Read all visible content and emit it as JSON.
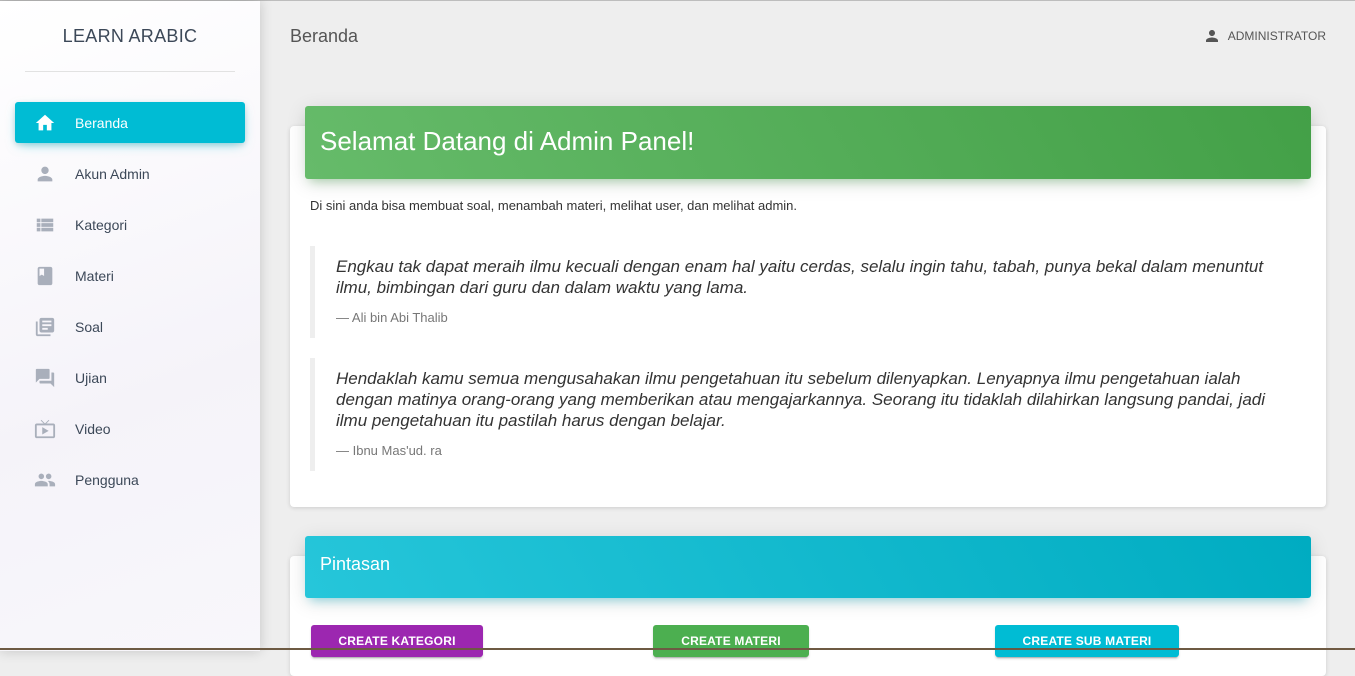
{
  "sidebar": {
    "brand": "LEARN ARABIC",
    "items": [
      {
        "label": "Beranda",
        "icon": "home-icon",
        "active": true
      },
      {
        "label": "Akun Admin",
        "icon": "person-icon"
      },
      {
        "label": "Kategori",
        "icon": "list-icon"
      },
      {
        "label": "Materi",
        "icon": "book-icon"
      },
      {
        "label": "Soal",
        "icon": "library-books-icon"
      },
      {
        "label": "Ujian",
        "icon": "forum-icon"
      },
      {
        "label": "Video",
        "icon": "live-tv-icon"
      },
      {
        "label": "Pengguna",
        "icon": "people-icon"
      }
    ]
  },
  "topbar": {
    "title": "Beranda",
    "user": "ADMINISTRATOR"
  },
  "welcome": {
    "title": "Selamat Datang di Admin Panel!",
    "intro": "Di sini anda bisa membuat soal, menambah materi, melihat user, dan melihat admin.",
    "quotes": [
      {
        "text": "Engkau tak dapat meraih ilmu kecuali dengan enam hal yaitu cerdas, selalu ingin tahu, tabah, punya bekal dalam menuntut ilmu, bimbingan dari guru dan dalam waktu yang lama.",
        "author": "— Ali bin Abi Thalib"
      },
      {
        "text": "Hendaklah kamu semua mengusahakan ilmu pengetahuan itu sebelum dilenyapkan. Lenyapnya ilmu pengetahuan ialah dengan matinya orang-orang yang memberikan atau mengajarkannya. Seorang itu tidaklah dilahirkan langsung pandai, jadi ilmu pengetahuan itu pastilah harus dengan belajar.",
        "author": "— Ibnu Mas'ud. ra"
      }
    ]
  },
  "shortcuts": {
    "title": "Pintasan",
    "buttons": [
      "CREATE KATEGORI",
      "CREATE MATERI",
      "CREATE SUB MATERI"
    ]
  },
  "colors": {
    "primary": "#00bcd4",
    "success": "#4caf50",
    "purple": "#9c27b0"
  }
}
